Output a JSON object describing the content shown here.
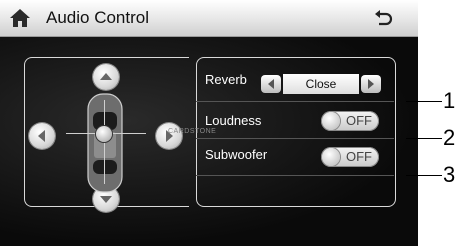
{
  "header": {
    "title": "Audio Control",
    "home_icon": "home-icon",
    "back_icon": "back-arrow-icon"
  },
  "balance": {
    "up_icon": "chevron-up-icon",
    "down_icon": "chevron-down-icon",
    "left_icon": "chevron-left-icon",
    "right_icon": "chevron-right-icon"
  },
  "settings": {
    "reverb": {
      "label": "Reverb",
      "value": "Close"
    },
    "loudness": {
      "label": "Loudness",
      "state": "OFF"
    },
    "subwoofer": {
      "label": "Subwoofer",
      "state": "OFF"
    }
  },
  "watermark": "CARDSTONE",
  "callouts": [
    "1",
    "2",
    "3"
  ]
}
